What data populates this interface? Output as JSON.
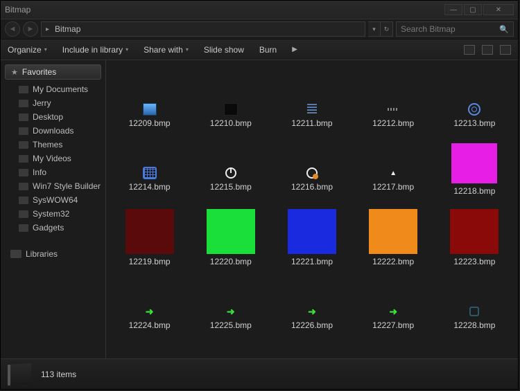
{
  "window": {
    "title": "Bitmap"
  },
  "nav": {
    "breadcrumb": "Bitmap",
    "search_placeholder": "Search Bitmap"
  },
  "toolbar": {
    "organize": "Organize",
    "include": "Include in library",
    "share": "Share with",
    "slideshow": "Slide show",
    "burn": "Burn"
  },
  "sidebar": {
    "favorites_label": "Favorites",
    "items": [
      {
        "label": "My Documents"
      },
      {
        "label": "Jerry"
      },
      {
        "label": "Desktop"
      },
      {
        "label": "Downloads"
      },
      {
        "label": "Themes"
      },
      {
        "label": "My Videos"
      },
      {
        "label": "Info"
      },
      {
        "label": "Win7 Style Builder"
      },
      {
        "label": "SysWOW64"
      },
      {
        "label": "System32"
      },
      {
        "label": "Gadgets"
      }
    ],
    "libraries_label": "Libraries"
  },
  "files": [
    {
      "name": "12209.bmp",
      "kind": "appicon"
    },
    {
      "name": "12210.bmp",
      "kind": "black"
    },
    {
      "name": "12211.bmp",
      "kind": "lines"
    },
    {
      "name": "12212.bmp",
      "kind": "dots"
    },
    {
      "name": "12213.bmp",
      "kind": "gear"
    },
    {
      "name": "12214.bmp",
      "kind": "keyboard"
    },
    {
      "name": "12215.bmp",
      "kind": "power"
    },
    {
      "name": "12216.bmp",
      "kind": "clock"
    },
    {
      "name": "12217.bmp",
      "kind": "caret"
    },
    {
      "name": "12218.bmp",
      "kind": "color",
      "color": "#e61ee6"
    },
    {
      "name": "12219.bmp",
      "kind": "color",
      "color": "#5a0a0a"
    },
    {
      "name": "12220.bmp",
      "kind": "color",
      "color": "#1adf3a"
    },
    {
      "name": "12221.bmp",
      "kind": "color",
      "color": "#1a2adf"
    },
    {
      "name": "12222.bmp",
      "kind": "color",
      "color": "#f08a1a"
    },
    {
      "name": "12223.bmp",
      "kind": "color",
      "color": "#8a0a0a"
    },
    {
      "name": "12224.bmp",
      "kind": "arrow"
    },
    {
      "name": "12225.bmp",
      "kind": "arrow"
    },
    {
      "name": "12226.bmp",
      "kind": "arrow"
    },
    {
      "name": "12227.bmp",
      "kind": "arrow"
    },
    {
      "name": "12228.bmp",
      "kind": "box"
    }
  ],
  "status": {
    "count_text": "113 items"
  }
}
